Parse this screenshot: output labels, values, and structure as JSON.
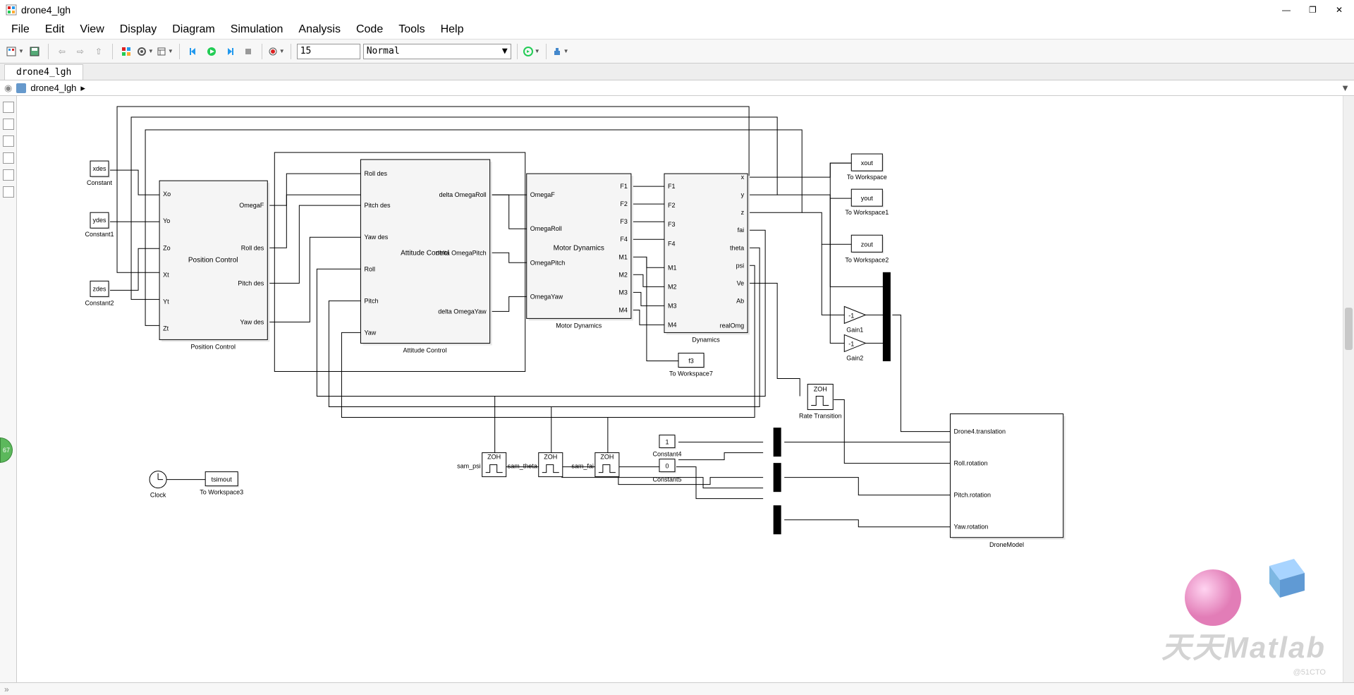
{
  "window": {
    "title": "drone4_lgh",
    "minimize": "—",
    "maximize": "❐",
    "close": "✕"
  },
  "menu": [
    "File",
    "Edit",
    "View",
    "Display",
    "Diagram",
    "Simulation",
    "Analysis",
    "Code",
    "Tools",
    "Help"
  ],
  "toolbar": {
    "stop_time": "15",
    "mode": "Normal"
  },
  "tabs": [
    "drone4_lgh"
  ],
  "breadcrumb": {
    "root": "drone4_lgh",
    "sep": "▸"
  },
  "palette_icons": [
    "zoom",
    "zoom-fit",
    "fit-view",
    "signal",
    "annotate",
    "image"
  ],
  "blocks": {
    "xdes": {
      "label": "xdes",
      "sub": "Constant"
    },
    "ydes": {
      "label": "ydes",
      "sub": "Constant1"
    },
    "zdes": {
      "label": "zdes",
      "sub": "Constant2"
    },
    "const4": {
      "label": "1",
      "sub": "Constant4"
    },
    "const5": {
      "label": "0",
      "sub": "Constant5"
    },
    "position": {
      "title": "Position Control",
      "sub": "Position Control",
      "in": [
        "Xo",
        "Yo",
        "Zo",
        "Xt",
        "Yt",
        "Zt"
      ],
      "out": [
        "OmegaF",
        "Roll des",
        "Pitch des",
        "Yaw des"
      ]
    },
    "attitude": {
      "title": "Attitude Control",
      "sub": "Attitude Control",
      "in": [
        "Roll des",
        "Pitch des",
        "Yaw des",
        "Roll",
        "Pitch",
        "Yaw"
      ],
      "out": [
        "delta OmegaRoll",
        "delta OmegaPitch",
        "delta OmegaYaw"
      ]
    },
    "motor": {
      "title": "Motor Dynamics",
      "sub": "Motor Dynamics",
      "in": [
        "OmegaF",
        "OmegaRoll",
        "OmegaPitch",
        "OmegaYaw"
      ],
      "out": [
        "F1",
        "F2",
        "F3",
        "F4",
        "M1",
        "M2",
        "M3",
        "M4"
      ]
    },
    "dynamics": {
      "title": "Dynamics",
      "in": [
        "F1",
        "F2",
        "F3",
        "F4",
        "M1",
        "M2",
        "M3",
        "M4"
      ],
      "out": [
        "x",
        "y",
        "z",
        "fai",
        "theta",
        "psi",
        "Ve",
        "Ab",
        "realOmg"
      ]
    },
    "xout": {
      "label": "xout",
      "sub": "To Workspace"
    },
    "yout": {
      "label": "yout",
      "sub": "To Workspace1"
    },
    "zout": {
      "label": "zout",
      "sub": "To Workspace2"
    },
    "tsimout": {
      "label": "tsimout",
      "sub": "To Workspace3"
    },
    "f3": {
      "label": "f3",
      "sub": "To Workspace7"
    },
    "gain1": {
      "value": "-1",
      "sub": "Gain1"
    },
    "gain2": {
      "value": "-1",
      "sub": "Gain2"
    },
    "rate": {
      "label": "ZOH",
      "sub": "Rate Transition"
    },
    "sam_psi": {
      "zoh": "ZOH",
      "label": "sam_psi"
    },
    "sam_theta": {
      "zoh": "ZOH",
      "label": "sam_theta"
    },
    "sam_fai": {
      "zoh": "ZOH",
      "label": "sam_fai"
    },
    "clock": {
      "sub": "Clock"
    },
    "dronemodel": {
      "sub": "DroneModel",
      "in": [
        "Drone4.translation",
        "Roll.rotation",
        "Pitch.rotation",
        "Yaw.rotation"
      ]
    }
  },
  "status": {
    "ready": "67"
  },
  "watermark": "天天Matlab",
  "watermark_sub": "@51CTO"
}
